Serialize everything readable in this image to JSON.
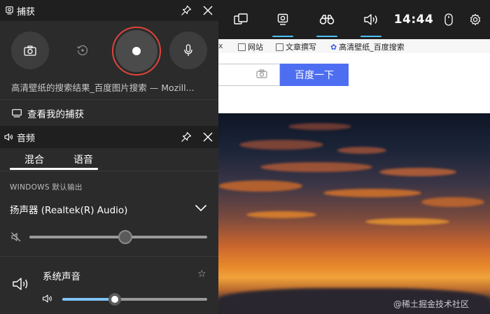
{
  "browser": {
    "bookmarks": [
      "网站",
      "文章撰写",
      "高清壁纸_百度搜索"
    ],
    "search_button": "百度一下"
  },
  "gamebar": {
    "time": "14:44",
    "buttons": [
      "widget-menu-icon",
      "capture-icon",
      "performance-icon",
      "audio-icon"
    ],
    "accent": "#4cc2ff"
  },
  "capture": {
    "title": "捕获",
    "target": "高清壁纸的搜索结果_百度图片搜索 — Mozill...",
    "view_captures": "查看我的捕获",
    "record_ring_color": "#e0443b"
  },
  "audio": {
    "title": "音频",
    "tabs": [
      {
        "label": "混合",
        "selected": true
      },
      {
        "label": "语音",
        "selected": false
      }
    ],
    "output_label": "WINDOWS 默认输出",
    "device": "扬声器 (Realtek(R) Audio)",
    "master_volume": 0.54,
    "app": {
      "name": "系统声音",
      "volume": 0.36,
      "accent": "#7fc3f5"
    }
  },
  "watermark": "@稀土掘金技术社区"
}
